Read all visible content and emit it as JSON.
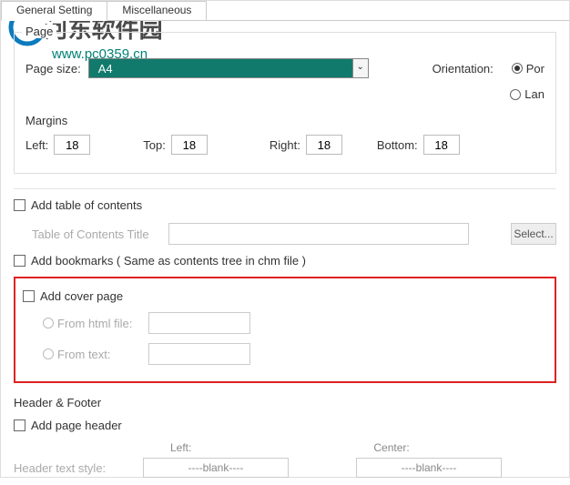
{
  "watermark": {
    "cn": "河东软件园",
    "url": "www.pc0359.cn"
  },
  "tabs": {
    "general": "General Setting",
    "misc": "Miscellaneous"
  },
  "page": {
    "group_title": "Page",
    "size_label": "Page size:",
    "size_value": "A4",
    "orientation_label": "Orientation:",
    "por": "Por",
    "lan": "Lan",
    "margins_label": "Margins",
    "left": "Left:",
    "left_v": "18",
    "top": "Top:",
    "top_v": "18",
    "right": "Right:",
    "right_v": "18",
    "bottom": "Bottom:",
    "bottom_v": "18"
  },
  "toc": {
    "add": "Add table of contents",
    "title_label": "Table of Contents Title",
    "select_btn": "Select..."
  },
  "bookmarks": {
    "add": "Add  bookmarks ( Same as contents tree in chm file )"
  },
  "cover": {
    "add": "Add cover page",
    "from_html": "From html file:",
    "from_text": "From  text:"
  },
  "hf": {
    "title": "Header & Footer",
    "add_header": "Add page header",
    "left_col": "Left:",
    "center_col": "Center:",
    "style_label": "Header text style:",
    "blank": "----blank----"
  }
}
